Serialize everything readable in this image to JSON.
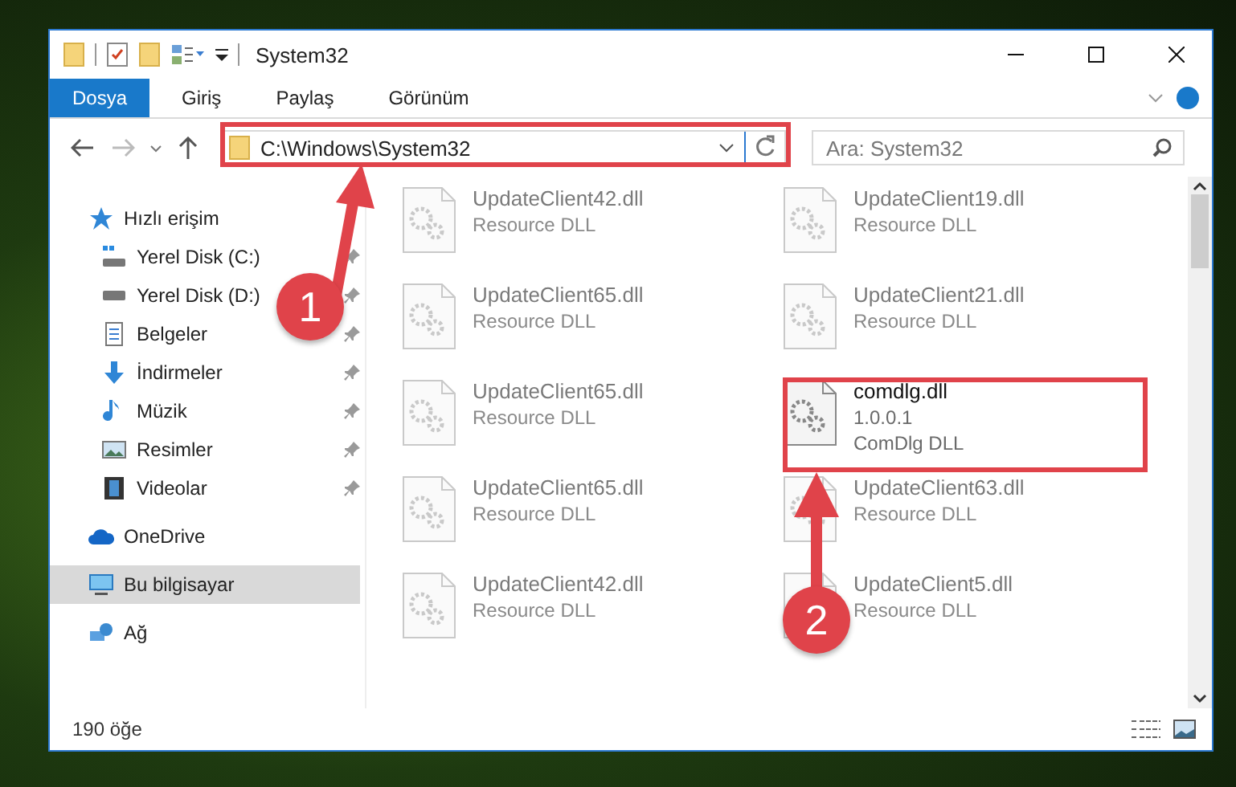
{
  "window": {
    "title": "System32"
  },
  "ribbon_tabs": [
    {
      "label": "Dosya",
      "selected": true
    },
    {
      "label": "Giriş",
      "selected": false
    },
    {
      "label": "Paylaş",
      "selected": false
    },
    {
      "label": "Görünüm",
      "selected": false
    }
  ],
  "address": {
    "path": "C:\\Windows\\System32"
  },
  "search": {
    "placeholder": "Ara: System32"
  },
  "sidebar": {
    "items": [
      {
        "label": "Hızlı erişim",
        "selected": false,
        "children": [
          {
            "label": "Yerel Disk (C:)",
            "pinned": true,
            "selected": false
          },
          {
            "label": "Yerel Disk (D:)",
            "pinned": true,
            "selected": false
          },
          {
            "label": "Belgeler",
            "pinned": true,
            "selected": false
          },
          {
            "label": "İndirmeler",
            "pinned": true,
            "selected": false
          },
          {
            "label": "Müzik",
            "pinned": true,
            "selected": false
          },
          {
            "label": "Resimler",
            "pinned": true,
            "selected": false
          },
          {
            "label": "Videolar",
            "pinned": true,
            "selected": false
          }
        ]
      },
      {
        "label": "OneDrive",
        "selected": false
      },
      {
        "label": "Bu bilgisayar",
        "selected": true
      },
      {
        "label": "Ağ",
        "selected": false
      }
    ]
  },
  "files": [
    {
      "name": "UpdateClient42.dll",
      "lines": [
        "Resource DLL"
      ],
      "kind": "faded"
    },
    {
      "name": "UpdateClient19.dll",
      "lines": [
        "Resource DLL"
      ],
      "kind": "faded"
    },
    {
      "name": "UpdateClient65.dll",
      "lines": [
        "Resource DLL"
      ],
      "kind": "faded"
    },
    {
      "name": "UpdateClient21.dll",
      "lines": [
        "Resource DLL"
      ],
      "kind": "faded"
    },
    {
      "name": "UpdateClient65.dll",
      "lines": [
        "Resource DLL"
      ],
      "kind": "faded"
    },
    {
      "name": "comdlg.dll",
      "lines": [
        "1.0.0.1",
        "ComDlg DLL"
      ],
      "kind": "normal"
    },
    {
      "name": "UpdateClient65.dll",
      "lines": [
        "Resource DLL"
      ],
      "kind": "faded"
    },
    {
      "name": "UpdateClient63.dll",
      "lines": [
        "Resource DLL"
      ],
      "kind": "faded"
    },
    {
      "name": "UpdateClient42.dll",
      "lines": [
        "Resource DLL"
      ],
      "kind": "faded"
    },
    {
      "name": "UpdateClient5.dll",
      "lines": [
        "Resource DLL"
      ],
      "kind": "faded"
    }
  ],
  "status_bar": {
    "count": "190 öğe"
  },
  "annotations": [
    {
      "number": "1"
    },
    {
      "number": "2"
    }
  ]
}
